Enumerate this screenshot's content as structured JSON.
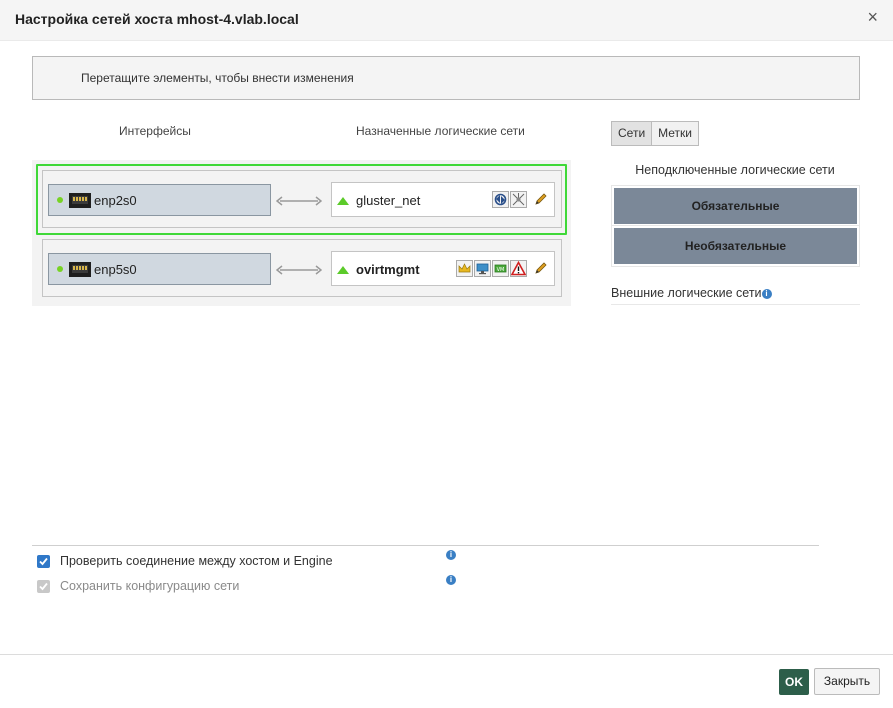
{
  "dialog": {
    "title": "Настройка сетей хоста mhost-4.vlab.local",
    "close_symbol": "×"
  },
  "hint": "Перетащите элементы, чтобы внести изменения",
  "columns": {
    "interfaces": "Интерфейсы",
    "assigned_networks": "Назначенные логические сети"
  },
  "rows": [
    {
      "nic": "enp2s0",
      "nic_status": "up",
      "network": "gluster_net",
      "network_bold": false,
      "selected": true,
      "icons": [
        "migration-icon",
        "gluster-icon"
      ]
    },
    {
      "nic": "enp5s0",
      "nic_status": "up",
      "network": "ovirtmgmt",
      "network_bold": true,
      "selected": false,
      "icons": [
        "management-crown-icon",
        "display-icon",
        "vm-network-icon",
        "warning-icon"
      ]
    }
  ],
  "right_panel": {
    "tab_networks": "Сети",
    "tab_labels": "Метки",
    "unattached_title": "Неподключенные логические сети",
    "required": "Обязательные",
    "optional": "Необязательные",
    "external_title": "Внешние логические сети"
  },
  "options": {
    "verify_connectivity": "Проверить соединение между хостом и Engine",
    "verify_checked": true,
    "save_config": "Сохранить конфигурацию сети",
    "save_checked": true,
    "save_disabled": true
  },
  "buttons": {
    "ok": "OK",
    "close": "Закрыть"
  },
  "colors": {
    "selected_border": "#3fd838",
    "nic_background": "#d0d8e0",
    "group_button": "#7b8898",
    "ok_button": "#2d5e4a",
    "status_up": "#77d324",
    "network_triangle": "#5ccb2a"
  }
}
